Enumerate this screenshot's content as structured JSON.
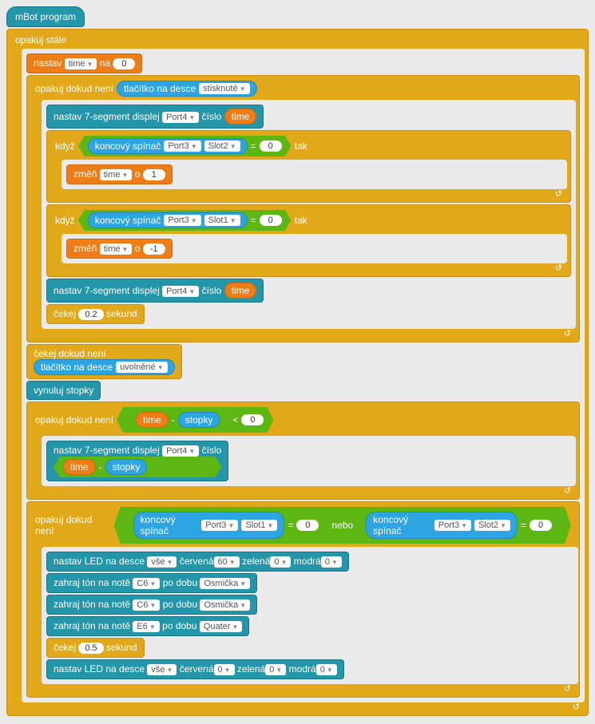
{
  "hat": "mBot program",
  "loop_forever": "opakuj stále",
  "set": "nastav",
  "to": "na",
  "var_time": "time",
  "repeat_until": "opakuj dokud není",
  "board_button": "tlačítko na desce",
  "pressed": "stisknuté",
  "released": "uvolněné",
  "set_7seg": "nastav 7-segment displej",
  "port4": "Port4",
  "port3": "Port3",
  "slot1": "Slot1",
  "slot2": "Slot2",
  "number": "číslo",
  "if": "když",
  "then": "tak",
  "limit_switch": "koncový spínač",
  "change": "změň",
  "by": "o",
  "wait": "čekej",
  "seconds": "sekund",
  "wait_until": "čekej dokud není",
  "reset_timer": "vynuluj stopky",
  "timer": "stopky",
  "or": "nebo",
  "set_led": "nastav LED na desce",
  "all": "vše",
  "red": "červená",
  "green": "zelená",
  "blue": "modrá",
  "play_tone": "zahraj tón na notě",
  "for_beat": "po dobu",
  "note_c6": "C6",
  "note_e6": "E6",
  "beat_eighth": "Osmička",
  "beat_quarter": "Quater",
  "v0": "0",
  "v1": "1",
  "vn1": "-1",
  "v02": "0.2",
  "v05": "0.5",
  "v60": "60",
  "lt": "<",
  "minus": "-",
  "eq": "="
}
